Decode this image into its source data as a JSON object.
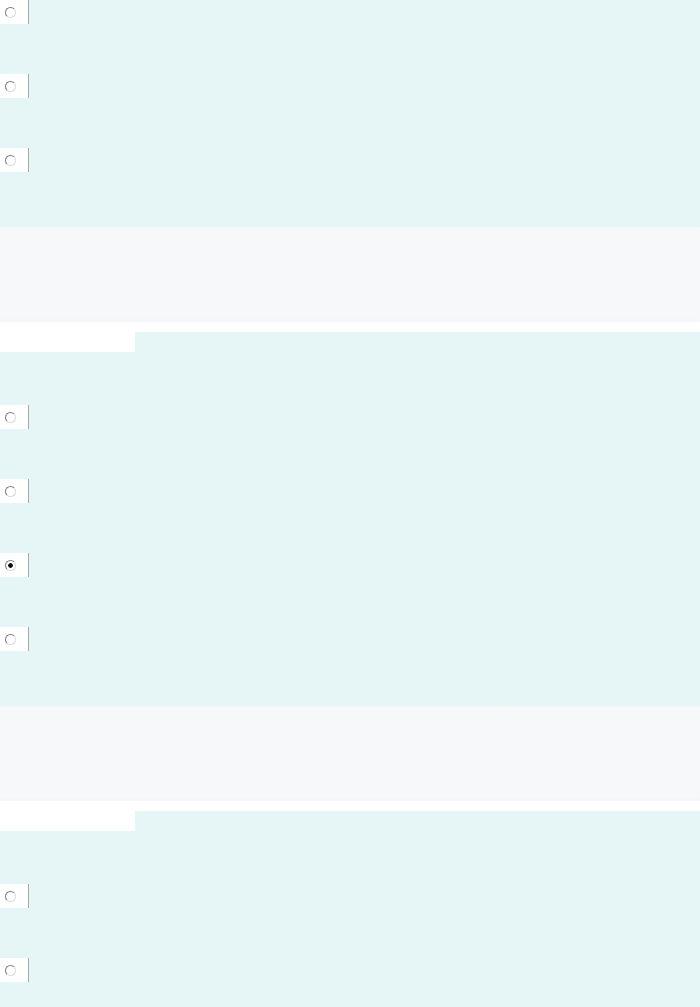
{
  "sections": [
    {
      "options": [
        {
          "selected": false
        },
        {
          "selected": false
        },
        {
          "selected": false
        }
      ]
    },
    {
      "options": [
        {
          "selected": false
        },
        {
          "selected": false
        },
        {
          "selected": true
        },
        {
          "selected": false
        }
      ]
    },
    {
      "options": [
        {
          "selected": false
        },
        {
          "selected": false
        }
      ]
    }
  ]
}
